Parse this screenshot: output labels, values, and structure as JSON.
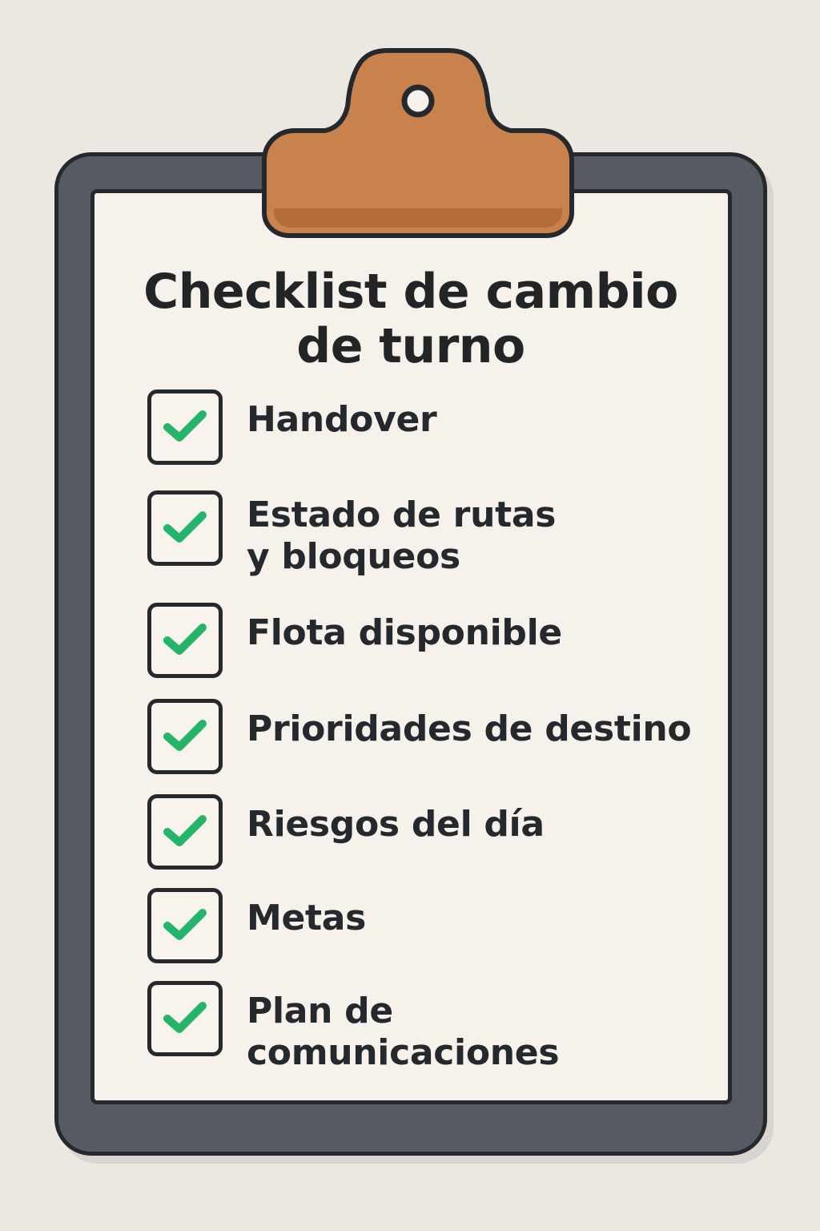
{
  "page": {
    "title_lines": [
      "Checklist de cambio",
      "de turno"
    ]
  },
  "checklist": {
    "items": [
      {
        "label_lines": [
          "Handover"
        ],
        "checked": true,
        "icon": "checkmark-icon"
      },
      {
        "label_lines": [
          "Estado de rutas",
          "y bloqueos"
        ],
        "checked": true,
        "icon": "checkmark-icon"
      },
      {
        "label_lines": [
          "Flota disponible"
        ],
        "checked": true,
        "icon": "checkmark-icon"
      },
      {
        "label_lines": [
          "Prioridades de destino"
        ],
        "checked": true,
        "icon": "checkmark-icon"
      },
      {
        "label_lines": [
          "Riesgos del día"
        ],
        "checked": true,
        "icon": "checkmark-icon"
      },
      {
        "label_lines": [
          "Metas"
        ],
        "checked": true,
        "icon": "checkmark-icon"
      },
      {
        "label_lines": [
          "Plan de comunicaciones"
        ],
        "checked": true,
        "icon": "checkmark-icon"
      }
    ]
  },
  "colors": {
    "background": "#ebe7e1",
    "board": "#555b61",
    "outline": "#25292d",
    "paper": "#f6f1ea",
    "clip": "#c9824c",
    "check": "#25b56a"
  },
  "icons": {
    "clipboard": "clipboard-icon",
    "clip": "clip-icon"
  }
}
